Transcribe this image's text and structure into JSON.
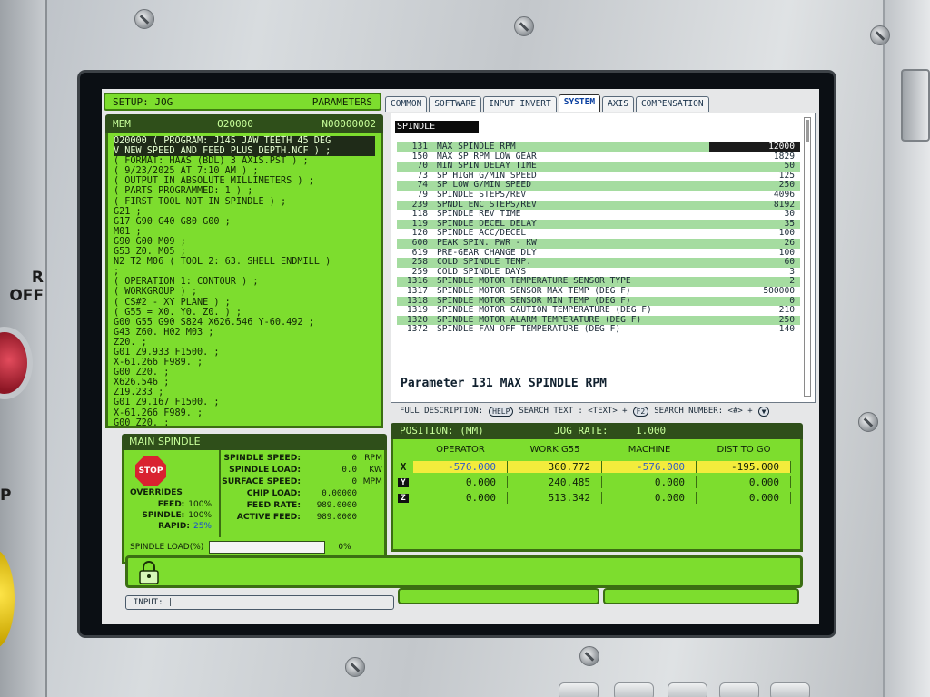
{
  "panel": {
    "off_label": "R OFF",
    "p_label": "P"
  },
  "header": {
    "setup_mode": "SETUP: JOG",
    "screen_title": "PARAMETERS"
  },
  "tabs": [
    "COMMON",
    "SOFTWARE",
    "INPUT INVERT",
    "SYSTEM",
    "AXIS",
    "COMPENSATION"
  ],
  "active_tab": "SYSTEM",
  "program": {
    "mem_label": "MEM",
    "o_number": "O20000",
    "n_number": "N00000002",
    "lines": [
      "O20000 ( PROGRAM: J145 JAW TEETH 45 DEG",
      "V NEW SPEED AND FEED PLUS DEPTH.NCF ) ;",
      "( FORMAT: HAAS (BDL) 3 AXIS.PST ) ;",
      "( 9/23/2025 AT 7:10 AM ) ;",
      "( OUTPUT IN ABSOLUTE MILLIMETERS ) ;",
      "( PARTS PROGRAMMED: 1 ) ;",
      "( FIRST TOOL NOT IN SPINDLE ) ;",
      "G21 ;",
      "G17 G90 G40 G80 G00 ;",
      "M01 ;",
      "G90 G00 M09 ;",
      "G53 Z0. M05 ;",
      "N2 T2 M06 ( TOOL 2: 63. SHELL ENDMILL )",
      ";",
      "( OPERATION 1: CONTOUR ) ;",
      "( WORKGROUP ) ;",
      "( CS#2 - XY PLANE ) ;",
      "( G55 = X0. Y0. Z0. ) ;",
      "G00 G55 G90 S824 X626.546 Y-60.492 ;",
      "G43 Z60. H02 M03 ;",
      "Z20. ;",
      "G01 Z9.933 F1500. ;",
      "X-61.266 F989. ;",
      "G00 Z20. ;",
      "X626.546 ;",
      "Z19.233 ;",
      "G01 Z9.167 F1500. ;",
      "X-61.266 F989. ;",
      "G00 Z20. ;"
    ]
  },
  "parameters": {
    "section": "SPINDLE",
    "rows": [
      {
        "num": "131",
        "name": "MAX SPINDLE RPM",
        "value": "12000",
        "hl": true,
        "sel": true
      },
      {
        "num": "150",
        "name": "MAX SP RPM LOW GEAR",
        "value": "1829",
        "hl": false
      },
      {
        "num": "70",
        "name": "MIN SPIN DELAY TIME",
        "value": "50",
        "hl": true
      },
      {
        "num": "73",
        "name": "SP HIGH G/MIN SPEED",
        "value": "125",
        "hl": false
      },
      {
        "num": "74",
        "name": "SP LOW G/MIN SPEED",
        "value": "250",
        "hl": true
      },
      {
        "num": "79",
        "name": "SPINDLE STEPS/REV",
        "value": "4096",
        "hl": false
      },
      {
        "num": "239",
        "name": "SPNDL ENC STEPS/REV",
        "value": "8192",
        "hl": true
      },
      {
        "num": "118",
        "name": "SPINDLE REV TIME",
        "value": "30",
        "hl": false
      },
      {
        "num": "119",
        "name": "SPINDLE DECEL DELAY",
        "value": "35",
        "hl": true
      },
      {
        "num": "120",
        "name": "SPINDLE ACC/DECEL",
        "value": "100",
        "hl": false
      },
      {
        "num": "600",
        "name": "PEAK SPIN. PWR - KW",
        "value": "26",
        "hl": true
      },
      {
        "num": "619",
        "name": "PRE-GEAR CHANGE DLY",
        "value": "100",
        "hl": false
      },
      {
        "num": "258",
        "name": "COLD SPINDLE TEMP.",
        "value": "60",
        "hl": true
      },
      {
        "num": "259",
        "name": "COLD SPINDLE DAYS",
        "value": "3",
        "hl": false
      },
      {
        "num": "1316",
        "name": "SPINDLE MOTOR TEMPERATURE SENSOR TYPE",
        "value": "2",
        "hl": true
      },
      {
        "num": "1317",
        "name": "SPINDLE MOTOR SENSOR MAX TEMP (DEG F)",
        "value": "500000",
        "hl": false
      },
      {
        "num": "1318",
        "name": "SPINDLE MOTOR SENSOR MIN TEMP (DEG F)",
        "value": "0",
        "hl": true
      },
      {
        "num": "1319",
        "name": "SPINDLE MOTOR CAUTION TEMPERATURE (DEG F)",
        "value": "210",
        "hl": false
      },
      {
        "num": "1320",
        "name": "SPINDLE MOTOR ALARM TEMPERATURE (DEG F)",
        "value": "250",
        "hl": true
      },
      {
        "num": "1372",
        "name": "SPINDLE FAN OFF TEMPERATURE (DEG F)",
        "value": "140",
        "hl": false
      }
    ],
    "description": "Parameter 131 MAX SPINDLE RPM",
    "footer": {
      "full_description": "FULL DESCRIPTION:",
      "help_key": "HELP",
      "search_text": "SEARCH TEXT : <TEXT> +",
      "f2_key": "F2",
      "search_number": "SEARCH NUMBER: <#> +",
      "down_key": "▼"
    }
  },
  "spindle": {
    "title": "MAIN SPINDLE",
    "stop_label": "STOP",
    "overrides_title": "OVERRIDES",
    "feed_label": "FEED:",
    "feed_value": "100%",
    "spindle_label": "SPINDLE:",
    "spindle_value": "100%",
    "rapid_label": "RAPID:",
    "rapid_value": "25%",
    "stats": [
      {
        "label": "SPINDLE SPEED:",
        "value": "0",
        "unit": "RPM"
      },
      {
        "label": "SPINDLE LOAD:",
        "value": "0.0",
        "unit": "KW"
      },
      {
        "label": "SURFACE SPEED:",
        "value": "0",
        "unit": "MPM"
      },
      {
        "label": "CHIP LOAD:",
        "value": "0.00000",
        "unit": ""
      },
      {
        "label": "FEED RATE:",
        "value": "989.0000",
        "unit": ""
      },
      {
        "label": "ACTIVE FEED:",
        "value": "989.0000",
        "unit": ""
      }
    ],
    "load_label": "SPINDLE LOAD(%)",
    "load_percent_text": "0%",
    "load_fraction": 0.0
  },
  "position": {
    "title": "POSITION: (MM)",
    "jog_rate_label": "JOG RATE:",
    "jog_rate_value": "1.000",
    "columns": [
      "OPERATOR",
      "WORK  G55",
      "MACHINE",
      "DIST TO GO"
    ],
    "rows": [
      {
        "axis": "X",
        "operator": "-576.000",
        "work": "360.772",
        "machine": "-576.000",
        "dist": "-195.000"
      },
      {
        "axis": "Y",
        "operator": "0.000",
        "work": "240.485",
        "machine": "0.000",
        "dist": "0.000"
      },
      {
        "axis": "Z",
        "operator": "0.000",
        "work": "513.342",
        "machine": "0.000",
        "dist": "0.000"
      }
    ]
  },
  "input": {
    "label": "INPUT: |"
  },
  "colors": {
    "screen_green": "#7ddd2e",
    "header_dark": "#2f4f1a",
    "param_highlight": "#a5dca0",
    "selected_row": "#f3ec3c"
  }
}
